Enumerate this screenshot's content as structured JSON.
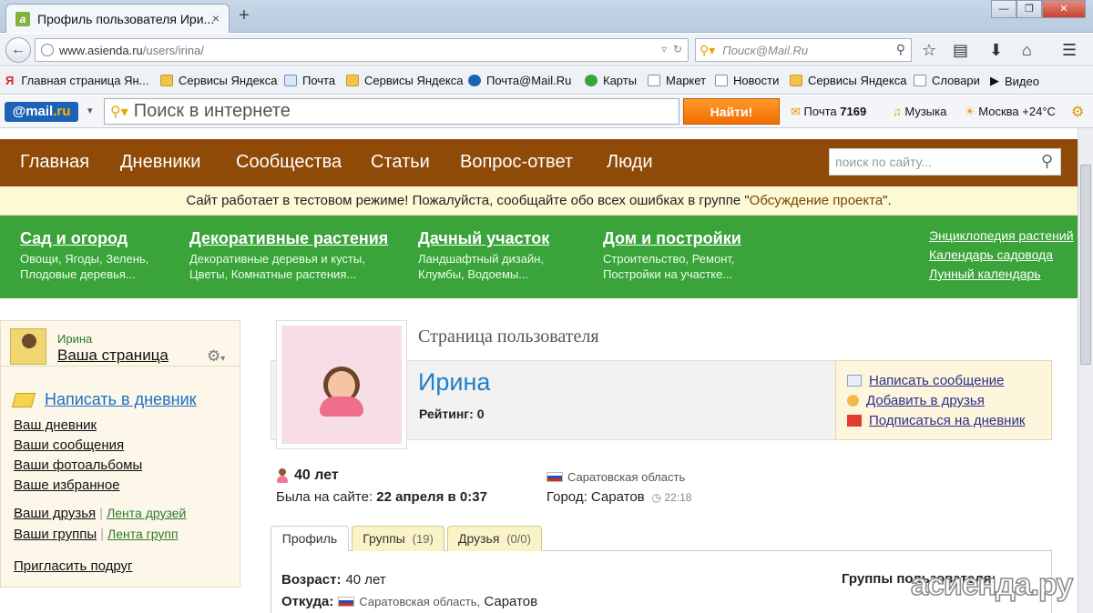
{
  "browser": {
    "tab_title": "Профиль пользователя Ири...",
    "tab_favicon": "a",
    "tab_close": "×",
    "new_tab": "+",
    "window_minimize": "—",
    "window_restore": "❐",
    "window_close": "✕",
    "url_host": "www.asienda.ru",
    "url_path": "/users/irina/",
    "search_placeholder": "Поиск@Mail.Ru"
  },
  "bookmarks": [
    {
      "label": "Главная страница Ян...",
      "icon": "yandex-icon"
    },
    {
      "label": "Сервисы Яндекса",
      "icon": "folder-icon"
    },
    {
      "label": "Почта",
      "icon": "mail-icon"
    },
    {
      "label": "Сервисы Яндекса",
      "icon": "folder-icon"
    },
    {
      "label": "Почта@Mail.Ru",
      "icon": "mailru-icon"
    },
    {
      "label": "Карты",
      "icon": "maps-icon"
    },
    {
      "label": "Маркет",
      "icon": "market-icon"
    },
    {
      "label": "Новости",
      "icon": "doc-icon"
    },
    {
      "label": "Сервисы Яндекса",
      "icon": "folder-icon"
    },
    {
      "label": "Словари",
      "icon": "dict-icon"
    },
    {
      "label": "Видео",
      "icon": "video-icon"
    }
  ],
  "mailru_bar": {
    "logo_prefix": "@mail",
    "logo_suffix": ".ru",
    "search_placeholder": "Поиск в интернете",
    "find_button": "Найти!",
    "mail_label": "Почта",
    "mail_count": "7169",
    "music_label": "Музыка",
    "weather": "Москва +24°C"
  },
  "site_nav": {
    "items": [
      "Главная",
      "Дневники",
      "Сообщества",
      "Статьи",
      "Вопрос-ответ",
      "Люди"
    ],
    "search_placeholder": "поиск по сайту..."
  },
  "notice": {
    "text": "Сайт работает в тестовом режиме! Пожалуйста, сообщайте обо всех ошибках в группе \"",
    "link": "Обсуждение проекта",
    "text_end": "\"."
  },
  "categories": [
    {
      "title": "Сад и огород",
      "sub1": "Овощи, Ягоды, Зелень,",
      "sub2": "Плодовые деревья..."
    },
    {
      "title": "Декоративные растения",
      "sub1": "Декоративные деревья и кусты,",
      "sub2": "Цветы, Комнатные растения..."
    },
    {
      "title": "Дачный участок",
      "sub1": "Ландшафтный дизайн,",
      "sub2": "Клумбы, Водоемы..."
    },
    {
      "title": "Дом и постройки",
      "sub1": "Строительство, Ремонт,",
      "sub2": "Постройки на участке..."
    }
  ],
  "category_links": [
    "Энциклопедия растений",
    "Календарь садовода",
    "Лунный календарь"
  ],
  "sidebar": {
    "user_name": "Ирина",
    "your_page": "Ваша страница",
    "write_diary": "Написать в дневник",
    "links": [
      "Ваш дневник",
      "Ваши сообщения",
      "Ваши фотоальбомы",
      "Ваше избранное"
    ],
    "friends": "Ваши друзья",
    "friends_feed": "Лента друзей",
    "groups": "Ваши группы",
    "groups_feed": "Лента групп",
    "invite": "Пригласить подруг"
  },
  "profile": {
    "page_title": "Страница пользователя",
    "username": "Ирина",
    "rating_label": "Рейтинг:",
    "rating_value": "0",
    "actions": [
      "Написать сообщение",
      "Добавить в друзья",
      "Подписаться на дневник"
    ],
    "age": "40 лет",
    "last_seen_label": "Была на сайте:",
    "last_seen_value": "22 апреля в 0:37",
    "region": "Саратовская область",
    "city_label": "Город:",
    "city": "Саратов",
    "local_time": "22:18"
  },
  "profile_tabs": [
    {
      "label": "Профиль",
      "count": ""
    },
    {
      "label": "Группы",
      "count": "(19)"
    },
    {
      "label": "Друзья",
      "count": "(0/0)"
    }
  ],
  "profile_fields": {
    "age_label": "Возраст:",
    "age_value": "40 лет",
    "from_label": "Откуда:",
    "from_region": "Саратовская область,",
    "from_city": "Саратов",
    "groups_heading": "Группы пользователя:"
  },
  "watermark": "асиенда.ру",
  "colors": {
    "nav_brown": "#8f4a07",
    "green_bar": "#3aa33a",
    "notice_bg": "#fdf9d5",
    "username_blue": "#1e7fc9",
    "find_orange": "#f26d00"
  }
}
